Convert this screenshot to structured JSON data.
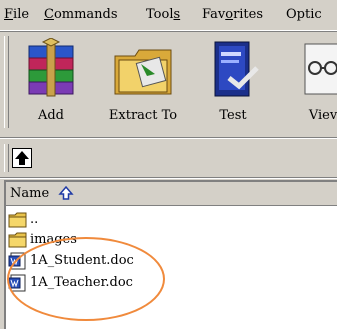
{
  "menu": {
    "items": [
      {
        "pre": "",
        "u": "F",
        "post": "ile"
      },
      {
        "pre": "",
        "u": "C",
        "post": "ommands"
      },
      {
        "pre": "Tool",
        "u": "s",
        "post": ""
      },
      {
        "pre": "Fav",
        "u": "o",
        "post": "rites"
      },
      {
        "pre": "Optic",
        "u": "",
        "post": ""
      }
    ]
  },
  "toolbar": {
    "buttons": [
      {
        "label": "Add",
        "icon": "add-archive-icon"
      },
      {
        "label": "Extract To",
        "icon": "extract-to-icon"
      },
      {
        "label": "Test",
        "icon": "test-icon"
      },
      {
        "label": "Viev",
        "icon": "view-icon"
      }
    ]
  },
  "filelist": {
    "column_name": "Name",
    "rows": [
      {
        "name": "..",
        "icon": "folder-icon"
      },
      {
        "name": "images",
        "icon": "folder-icon"
      },
      {
        "name": "1A_Student.doc",
        "icon": "word-document-icon"
      },
      {
        "name": "1A_Teacher.doc",
        "icon": "word-document-icon"
      }
    ]
  },
  "colors": {
    "chrome": "#d4d0c8",
    "highlight_circle": "#f08a3c"
  }
}
